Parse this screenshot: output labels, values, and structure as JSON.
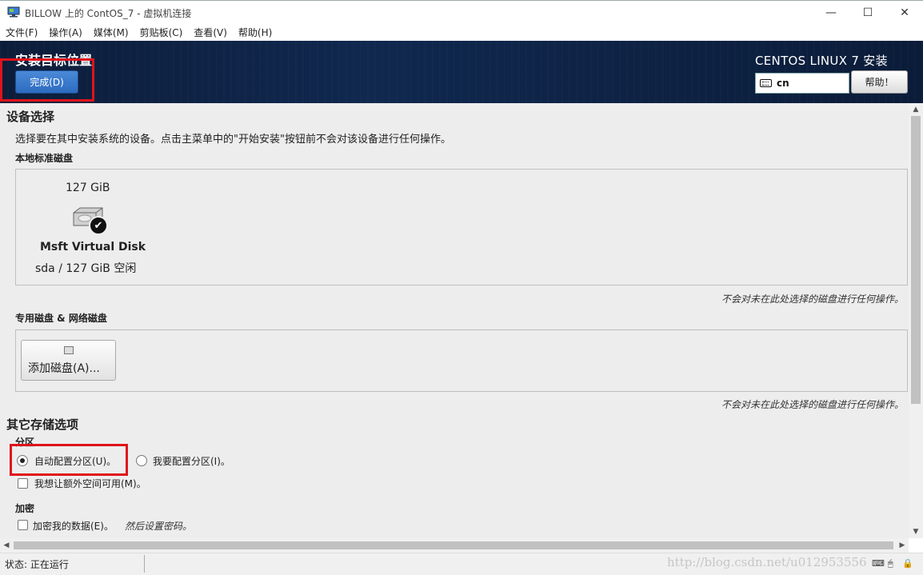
{
  "window": {
    "title": "BILLOW 上的 ContOS_7 - 虚拟机连接",
    "minimize": "—",
    "maximize": "☐",
    "close": "✕"
  },
  "menubar": {
    "items": [
      "文件(F)",
      "操作(A)",
      "媒体(M)",
      "剪贴板(C)",
      "查看(V)",
      "帮助(H)"
    ]
  },
  "header": {
    "spoke_title": "安装目标位置",
    "done_button": "完成(D)",
    "product": "CENTOS LINUX 7 安装",
    "keyboard_layout": "cn",
    "help_button": "帮助！"
  },
  "device_selection": {
    "heading": "设备选择",
    "description": "选择要在其中安装系统的设备。点击主菜单中的\"开始安装\"按钮前不会对该设备进行任何操作。",
    "local_label": "本地标准磁盘",
    "disk": {
      "size": "127 GiB",
      "name": "Msft Virtual Disk",
      "free": "sda  /  127 GiB 空闲"
    },
    "local_note": "不会对未在此处选择的磁盘进行任何操作。",
    "specialized_label": "专用磁盘 & 网络磁盘",
    "add_disk_button": "添加磁盘(A)...",
    "specialized_note": "不会对未在此处选择的磁盘进行任何操作。"
  },
  "other_storage": {
    "heading": "其它存储选项",
    "partition_label": "分区",
    "auto_partition": "自动配置分区(U)。",
    "manual_partition": "我要配置分区(I)。",
    "extra_space": "我想让额外空间可用(M)。",
    "encryption_label": "加密",
    "encrypt_data": "加密我的数据(E)。",
    "encrypt_hint": "然后设置密码。"
  },
  "statusbar": {
    "status": "状态: 正在运行",
    "watermark": "http://blog.csdn.net/u012953556"
  }
}
